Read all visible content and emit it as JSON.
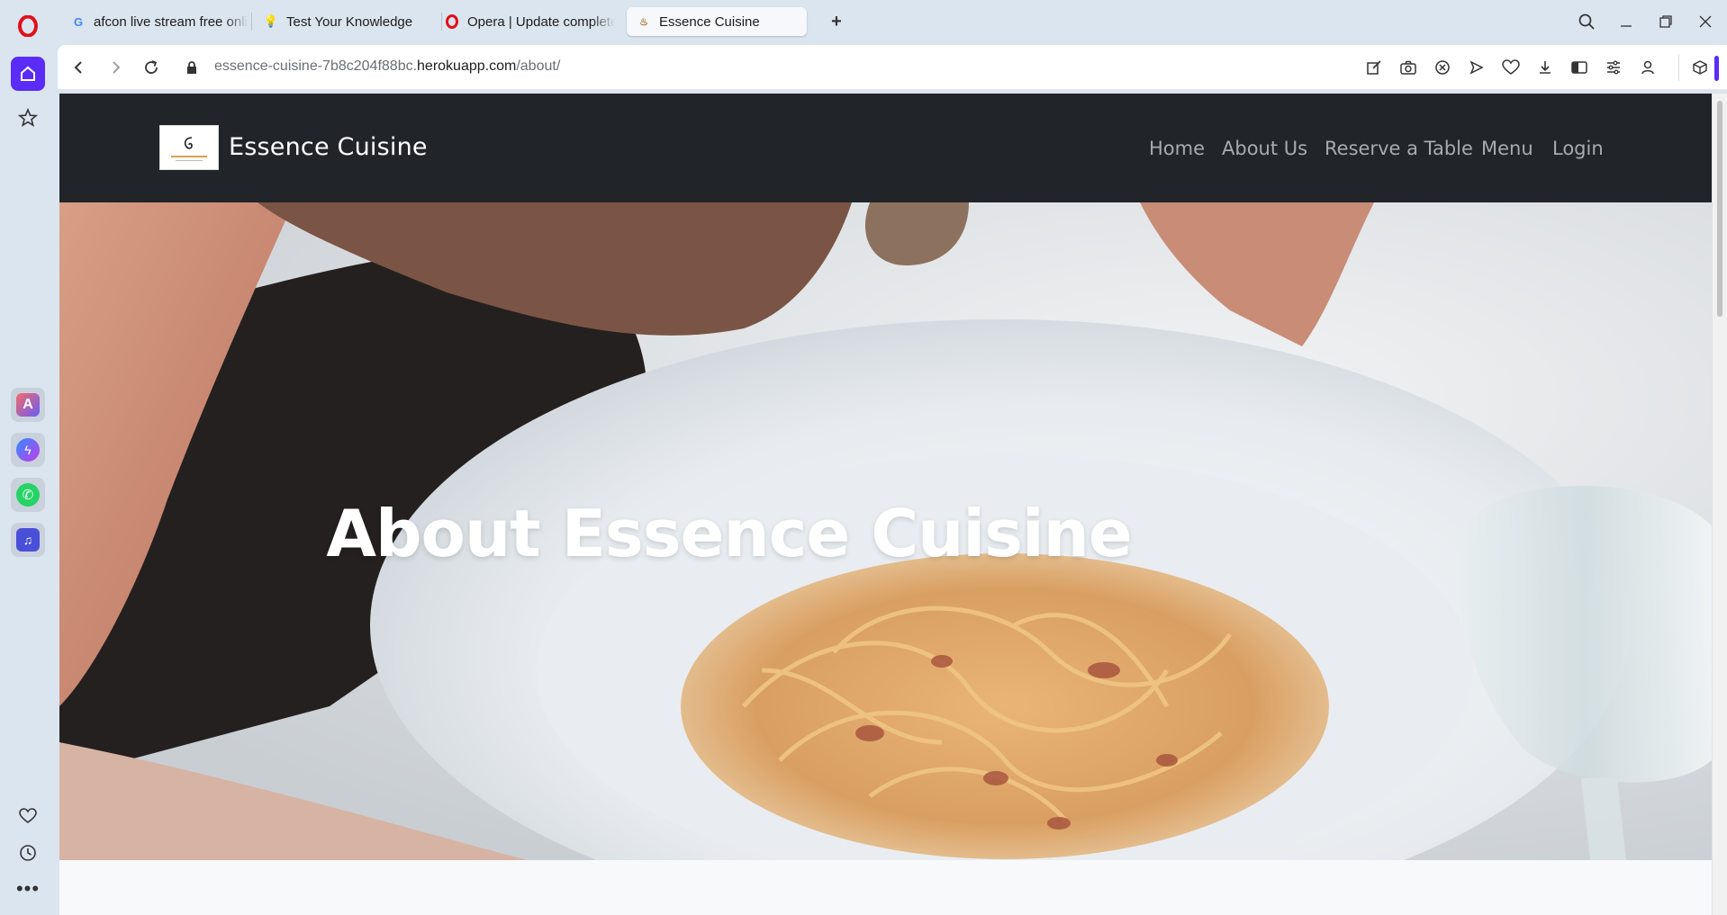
{
  "tabs": [
    {
      "label": "afcon live stream free online",
      "icon": "google-icon",
      "active": false
    },
    {
      "label": "Test Your Knowledge",
      "icon": "lightbulb-icon",
      "active": false
    },
    {
      "label": "Opera | Update complete",
      "icon": "opera-icon",
      "active": false
    },
    {
      "label": "Essence Cuisine",
      "icon": "essence-favicon",
      "active": true
    }
  ],
  "address": {
    "url_prefix": "essence-cuisine-7b8c204f88bc.",
    "url_domain": "herokuapp.com",
    "url_path": "/about/"
  },
  "site": {
    "brand": "Essence Cuisine",
    "nav": [
      "Home",
      "About Us",
      "Reserve a Table",
      "Menu",
      "Login"
    ],
    "hero_title": "About Essence Cuisine"
  },
  "colors": {
    "navbar_bg": "#212529",
    "opera_red": "#e0101b",
    "accent": "#5b2cf5"
  }
}
